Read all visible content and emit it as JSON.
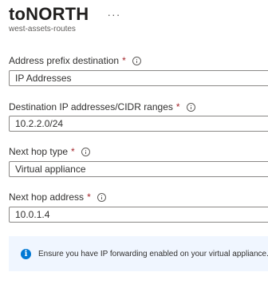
{
  "header": {
    "title": "toNORTH",
    "more_icon": "ellipsis-icon",
    "more_glyph": "···",
    "subtitle": "west-assets-routes"
  },
  "fields": {
    "address_prefix_destination": {
      "label": "Address prefix destination",
      "required_mark": "*",
      "value": "IP Addresses"
    },
    "destination_ip": {
      "label": "Destination IP addresses/CIDR ranges",
      "required_mark": "*",
      "value": "10.2.2.0/24"
    },
    "next_hop_type": {
      "label": "Next hop type",
      "required_mark": "*",
      "value": "Virtual appliance"
    },
    "next_hop_address": {
      "label": "Next hop address",
      "required_mark": "*",
      "value": "10.0.1.4"
    }
  },
  "notice": {
    "icon": "info-filled-icon",
    "glyph": "i",
    "text": "Ensure you have IP forwarding enabled on your virtual appliance."
  },
  "colors": {
    "required": "#a4262c",
    "accent": "#0078d4",
    "notice_bg": "#f0f6ff",
    "input_border": "#8a8886"
  }
}
